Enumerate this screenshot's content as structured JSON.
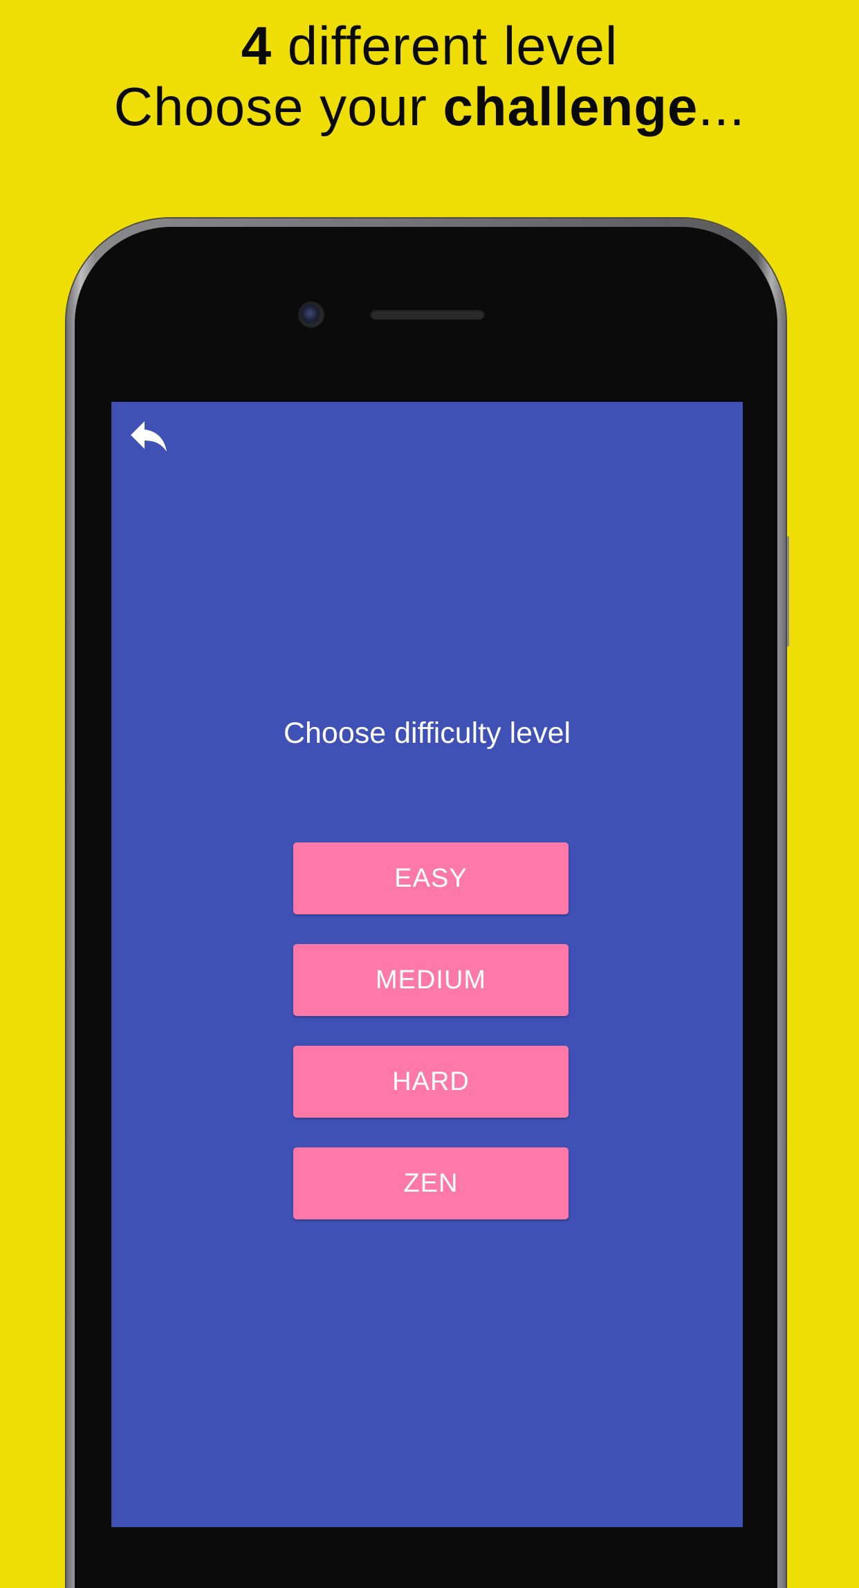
{
  "promo": {
    "line1_bold": "4",
    "line1_rest": " different level",
    "line2_start": "Choose your ",
    "line2_bold": "challenge",
    "line2_end": "..."
  },
  "screen": {
    "back_icon": "reply-arrow-icon",
    "title": "Choose difficulty level",
    "levels": [
      "EASY",
      "MEDIUM",
      "HARD",
      "ZEN"
    ]
  },
  "colors": {
    "background": "#efdd06",
    "screen": "#3f51b5",
    "button": "#ff79a8",
    "button_text": "#ffffff"
  }
}
